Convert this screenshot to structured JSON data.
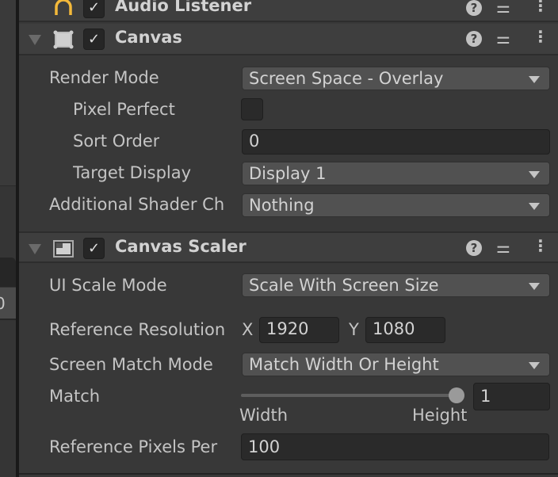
{
  "left_panel": {
    "partial_value": "0"
  },
  "components": [
    {
      "title": "Audio Listener",
      "enabled": true,
      "icon": "headphones-icon"
    },
    {
      "title": "Canvas",
      "enabled": true,
      "icon": "canvas-rect-icon",
      "fields": {
        "render_mode": {
          "label": "Render Mode",
          "value": "Screen Space - Overlay"
        },
        "pixel_perfect": {
          "label": "Pixel Perfect",
          "checked": false
        },
        "sort_order": {
          "label": "Sort Order",
          "value": "0"
        },
        "target_display": {
          "label": "Target Display",
          "value": "Display 1"
        },
        "additional_shader": {
          "label": "Additional Shader Ch",
          "value": "Nothing"
        }
      }
    },
    {
      "title": "Canvas Scaler",
      "enabled": true,
      "icon": "canvas-scaler-icon",
      "fields": {
        "ui_scale_mode": {
          "label": "UI Scale Mode",
          "value": "Scale With Screen Size"
        },
        "reference_resolution": {
          "label": "Reference Resolution",
          "x_label": "X",
          "x": "1920",
          "y_label": "Y",
          "y": "1080"
        },
        "screen_match_mode": {
          "label": "Screen Match Mode",
          "value": "Match Width Or Height"
        },
        "match": {
          "label": "Match",
          "value": "1",
          "slider_fraction": 1,
          "min_label": "Width",
          "max_label": "Height"
        },
        "reference_pixels": {
          "label": "Reference Pixels Per",
          "value": "100"
        }
      }
    }
  ],
  "header_icons": {
    "help": "?",
    "presets": "⊶",
    "menu": "⋮"
  },
  "colors": {
    "bg": "#383838",
    "header": "#3e3e3e",
    "audio_icon": "#f4b93a"
  }
}
